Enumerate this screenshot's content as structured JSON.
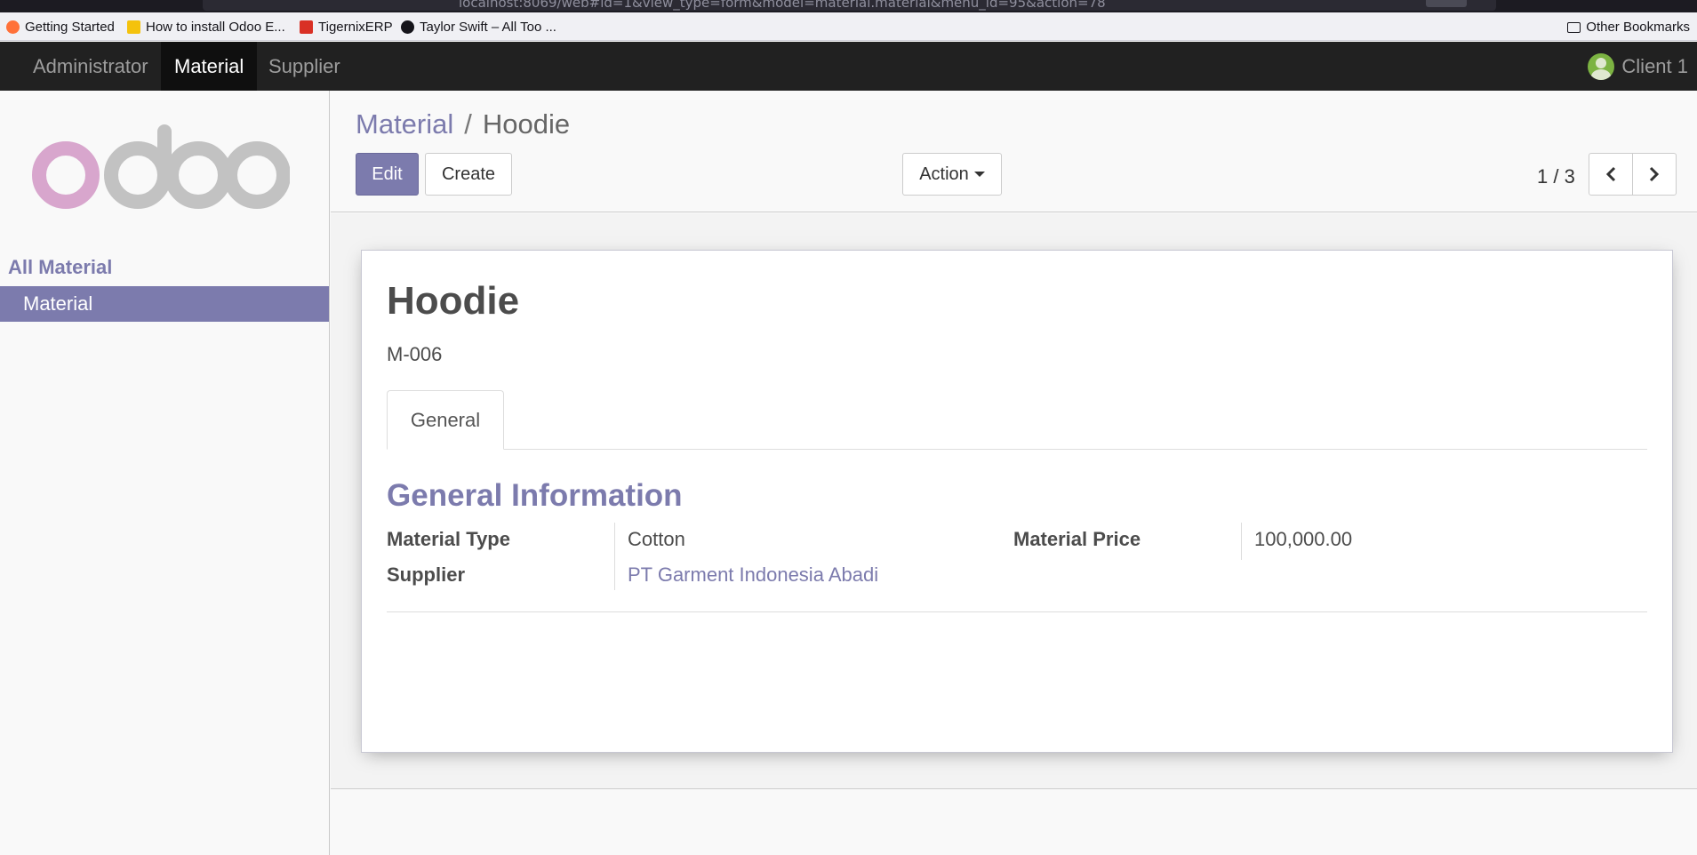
{
  "browser": {
    "url": "localhost:8069/web#id=1&view_type=form&model=material.material&menu_id=95&action=78",
    "bookmarks": [
      "Getting Started",
      "How to install Odoo E...",
      "TigernixERP",
      "Taylor Swift – All Too ..."
    ],
    "other_bookmarks": "Other Bookmarks"
  },
  "navbar": {
    "menus": [
      "Administrator",
      "Material",
      "Supplier"
    ],
    "active": "Material",
    "user": "Client 1"
  },
  "sidebar": {
    "logo_text": "odoo",
    "heading": "All Material",
    "items": [
      {
        "label": "Material",
        "active": true
      }
    ]
  },
  "control_panel": {
    "breadcrumb": {
      "parent": "Material",
      "separator": "/",
      "current": "Hoodie"
    },
    "buttons": {
      "edit": "Edit",
      "create": "Create",
      "action": "Action"
    },
    "pager": "1 / 3"
  },
  "form": {
    "name": "Hoodie",
    "code": "M-006",
    "tabs": [
      "General"
    ],
    "section_title": "General Information",
    "fields": {
      "material_type": {
        "label": "Material Type",
        "value": "Cotton"
      },
      "supplier": {
        "label": "Supplier",
        "value": "PT Garment Indonesia Abadi"
      },
      "material_price": {
        "label": "Material Price",
        "value": "100,000.00"
      }
    }
  },
  "colors": {
    "brand": "#7c7bad",
    "navbar": "#212121",
    "logo_pink": "#d8a6cd",
    "logo_gray": "#c2c2c2"
  }
}
